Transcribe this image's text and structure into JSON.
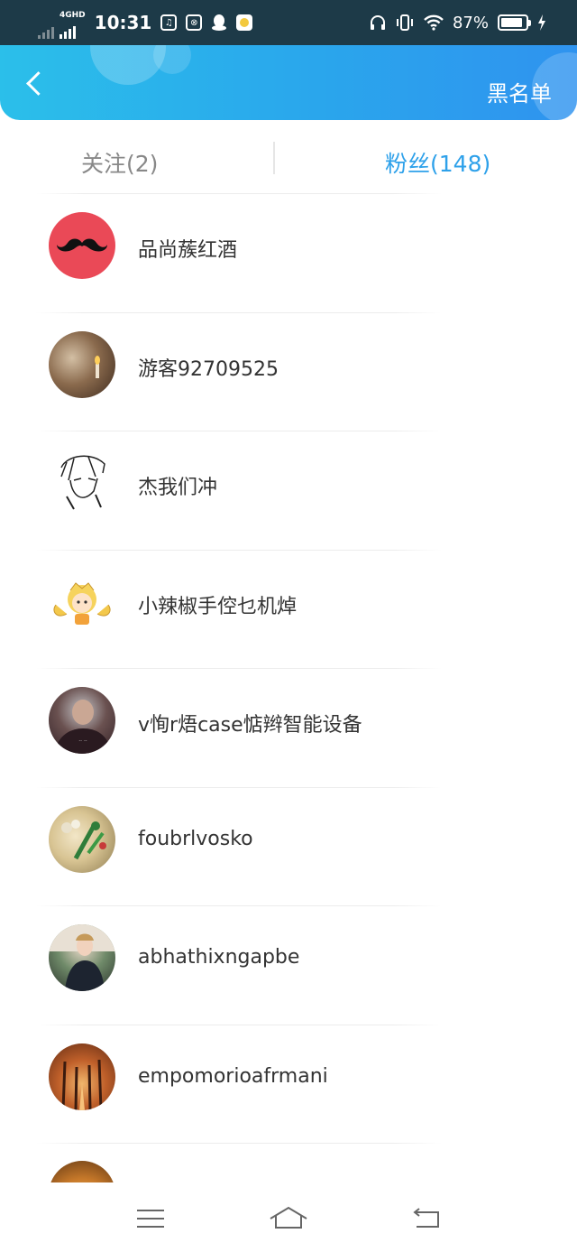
{
  "status_bar": {
    "network": "4GHD",
    "time": "10:31",
    "battery_percent": "87%",
    "battery_level": 0.87,
    "icons": [
      "signal-weak-icon",
      "signal-icon",
      "music-icon",
      "app-icon",
      "qq-icon",
      "chat-app-icon",
      "headphones-icon",
      "vibrate-icon",
      "wifi-icon",
      "battery-icon",
      "charging-icon"
    ]
  },
  "header": {
    "back_icon": "chevron-left-icon",
    "blacklist_label": "黑名单",
    "gradient_colors": [
      "#2bbfea",
      "#2f93ef"
    ]
  },
  "tabs": {
    "follow_label": "关注(2)",
    "fans_label": "粉丝(148)",
    "active": "fans",
    "active_color": "#2ea1ea"
  },
  "fans": [
    {
      "name": "品尚蔟红酒",
      "avatar": "mustache-avatar"
    },
    {
      "name": "游客92709525",
      "avatar": "candle-photo-avatar"
    },
    {
      "name": "杰我们冲",
      "avatar": "sketch-avatar"
    },
    {
      "name": "小辣椒手倥乜机焯",
      "avatar": "cartoon-avatar"
    },
    {
      "name": "v恂r焐case惦辫智能设备",
      "avatar": "person-photo-avatar"
    },
    {
      "name": "foubrlvosko",
      "avatar": "flower-photo-avatar"
    },
    {
      "name": "abhathixngapbe",
      "avatar": "man-photo-avatar"
    },
    {
      "name": "empomorioafrmani",
      "avatar": "autumn-photo-avatar"
    }
  ],
  "navbar": {
    "icons": [
      "menu-icon",
      "home-icon",
      "back-icon"
    ]
  }
}
